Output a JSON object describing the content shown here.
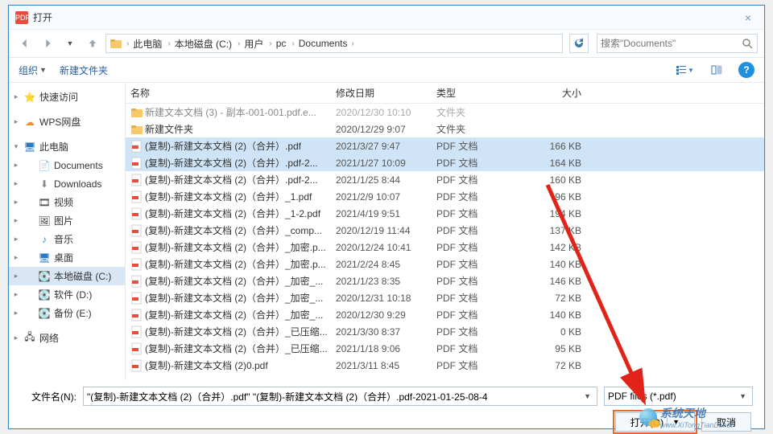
{
  "window": {
    "title": "打开",
    "close": "×"
  },
  "breadcrumb": {
    "root": "此电脑",
    "parts": [
      "本地磁盘 (C:)",
      "用户",
      "pc",
      "Documents"
    ]
  },
  "search": {
    "placeholder": "搜索\"Documents\""
  },
  "toolbar": {
    "organize": "组织",
    "new_folder": "新建文件夹",
    "help": "?"
  },
  "columns": {
    "name": "名称",
    "date": "修改日期",
    "type": "类型",
    "size": "大小"
  },
  "sidebar": {
    "quick": "快速访问",
    "wps": "WPS网盘",
    "pc": "此电脑",
    "documents": "Documents",
    "downloads": "Downloads",
    "videos": "视频",
    "pictures": "图片",
    "music": "音乐",
    "desktop": "桌面",
    "drive_c": "本地磁盘 (C:)",
    "drive_d": "软件 (D:)",
    "drive_e": "备份 (E:)",
    "network": "网络"
  },
  "files": [
    {
      "icon": "folder",
      "name": "新建文本文档 (3) - 副本-001-001.pdf.e...",
      "date": "2020/12/30 10:10",
      "type": "文件夹",
      "size": "",
      "dim": true
    },
    {
      "icon": "folder",
      "name": "新建文件夹",
      "date": "2020/12/29 9:07",
      "type": "文件夹",
      "size": ""
    },
    {
      "icon": "pdf",
      "name": "(复制)-新建文本文档 (2)（合并）.pdf",
      "date": "2021/3/27 9:47",
      "type": "PDF 文档",
      "size": "166 KB",
      "sel": true
    },
    {
      "icon": "pdf",
      "name": "(复制)-新建文本文档 (2)（合并）.pdf-2...",
      "date": "2021/1/27 10:09",
      "type": "PDF 文档",
      "size": "164 KB",
      "sel": true
    },
    {
      "icon": "pdf",
      "name": "(复制)-新建文本文档 (2)（合并）.pdf-2...",
      "date": "2021/1/25 8:44",
      "type": "PDF 文档",
      "size": "160 KB"
    },
    {
      "icon": "pdf",
      "name": "(复制)-新建文本文档 (2)（合并）_1.pdf",
      "date": "2021/2/9 10:07",
      "type": "PDF 文档",
      "size": "96 KB"
    },
    {
      "icon": "pdf",
      "name": "(复制)-新建文本文档 (2)（合并）_1-2.pdf",
      "date": "2021/4/19 9:51",
      "type": "PDF 文档",
      "size": "194 KB"
    },
    {
      "icon": "pdf",
      "name": "(复制)-新建文本文档 (2)（合并）_comp...",
      "date": "2020/12/19 11:44",
      "type": "PDF 文档",
      "size": "137 KB"
    },
    {
      "icon": "pdf",
      "name": "(复制)-新建文本文档 (2)（合并）_加密.p...",
      "date": "2020/12/24 10:41",
      "type": "PDF 文档",
      "size": "142 KB"
    },
    {
      "icon": "pdf",
      "name": "(复制)-新建文本文档 (2)（合并）_加密.p...",
      "date": "2021/2/24 8:45",
      "type": "PDF 文档",
      "size": "140 KB"
    },
    {
      "icon": "pdf",
      "name": "(复制)-新建文本文档 (2)（合并）_加密_...",
      "date": "2021/1/23 8:35",
      "type": "PDF 文档",
      "size": "146 KB"
    },
    {
      "icon": "pdf",
      "name": "(复制)-新建文本文档 (2)（合并）_加密_...",
      "date": "2020/12/31 10:18",
      "type": "PDF 文档",
      "size": "72 KB"
    },
    {
      "icon": "pdf",
      "name": "(复制)-新建文本文档 (2)（合并）_加密_...",
      "date": "2020/12/30 9:29",
      "type": "PDF 文档",
      "size": "140 KB"
    },
    {
      "icon": "pdf",
      "name": "(复制)-新建文本文档 (2)（合并）_已压缩...",
      "date": "2021/3/30 8:37",
      "type": "PDF 文档",
      "size": "0 KB"
    },
    {
      "icon": "pdf",
      "name": "(复制)-新建文本文档 (2)（合并）_已压缩...",
      "date": "2021/1/18 9:06",
      "type": "PDF 文档",
      "size": "95 KB"
    },
    {
      "icon": "pdf",
      "name": "(复制)-新建文本文档 (2)0.pdf",
      "date": "2021/3/11 8:45",
      "type": "PDF 文档",
      "size": "72 KB"
    }
  ],
  "footer": {
    "filename_label": "文件名(N):",
    "filename_value": "\"(复制)-新建文本文档 (2)（合并）.pdf\" \"(复制)-新建文本文档 (2)（合并）.pdf-2021-01-25-08-4",
    "filter": "PDF files (*.pdf)",
    "open": "打开(O)",
    "cancel": "取消"
  },
  "watermark": {
    "text": "系统天地",
    "url": "www.XiTongTianDi.net"
  }
}
